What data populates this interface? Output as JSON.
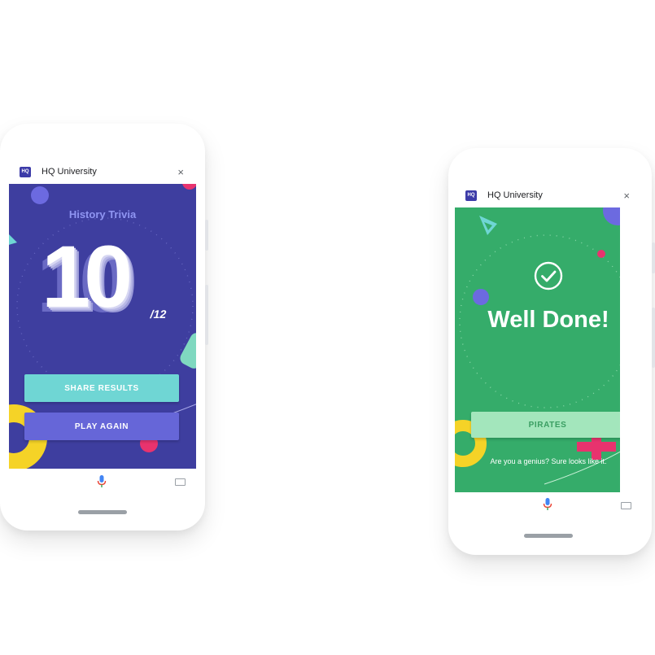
{
  "left_phone": {
    "app_bar": {
      "title": "HQ University",
      "logo_text": "HQ",
      "close_glyph": "×"
    },
    "screen": {
      "category": "History Trivia",
      "score": "10",
      "score_total": "/12",
      "share_button": "SHARE RESULTS",
      "play_again_button": "PLAY AGAIN"
    }
  },
  "right_phone": {
    "app_bar": {
      "title": "HQ University",
      "logo_text": "HQ",
      "close_glyph": "×"
    },
    "screen": {
      "headline": "Well Done!",
      "answer_button": "PIRATES",
      "caption": "Are you a genius? Sure looks like it."
    }
  },
  "icons": {
    "mic": "mic-icon",
    "keyboard": "keyboard-icon",
    "check": "check-circle-icon"
  },
  "colors": {
    "left_bg": "#3e3e9f",
    "right_bg": "#35ac6a",
    "share_button": "#6fd6d4",
    "play_button": "#6666d8",
    "answer_button": "#a3e6bc",
    "accent_pink": "#e8336e",
    "accent_yellow": "#f5d327"
  }
}
